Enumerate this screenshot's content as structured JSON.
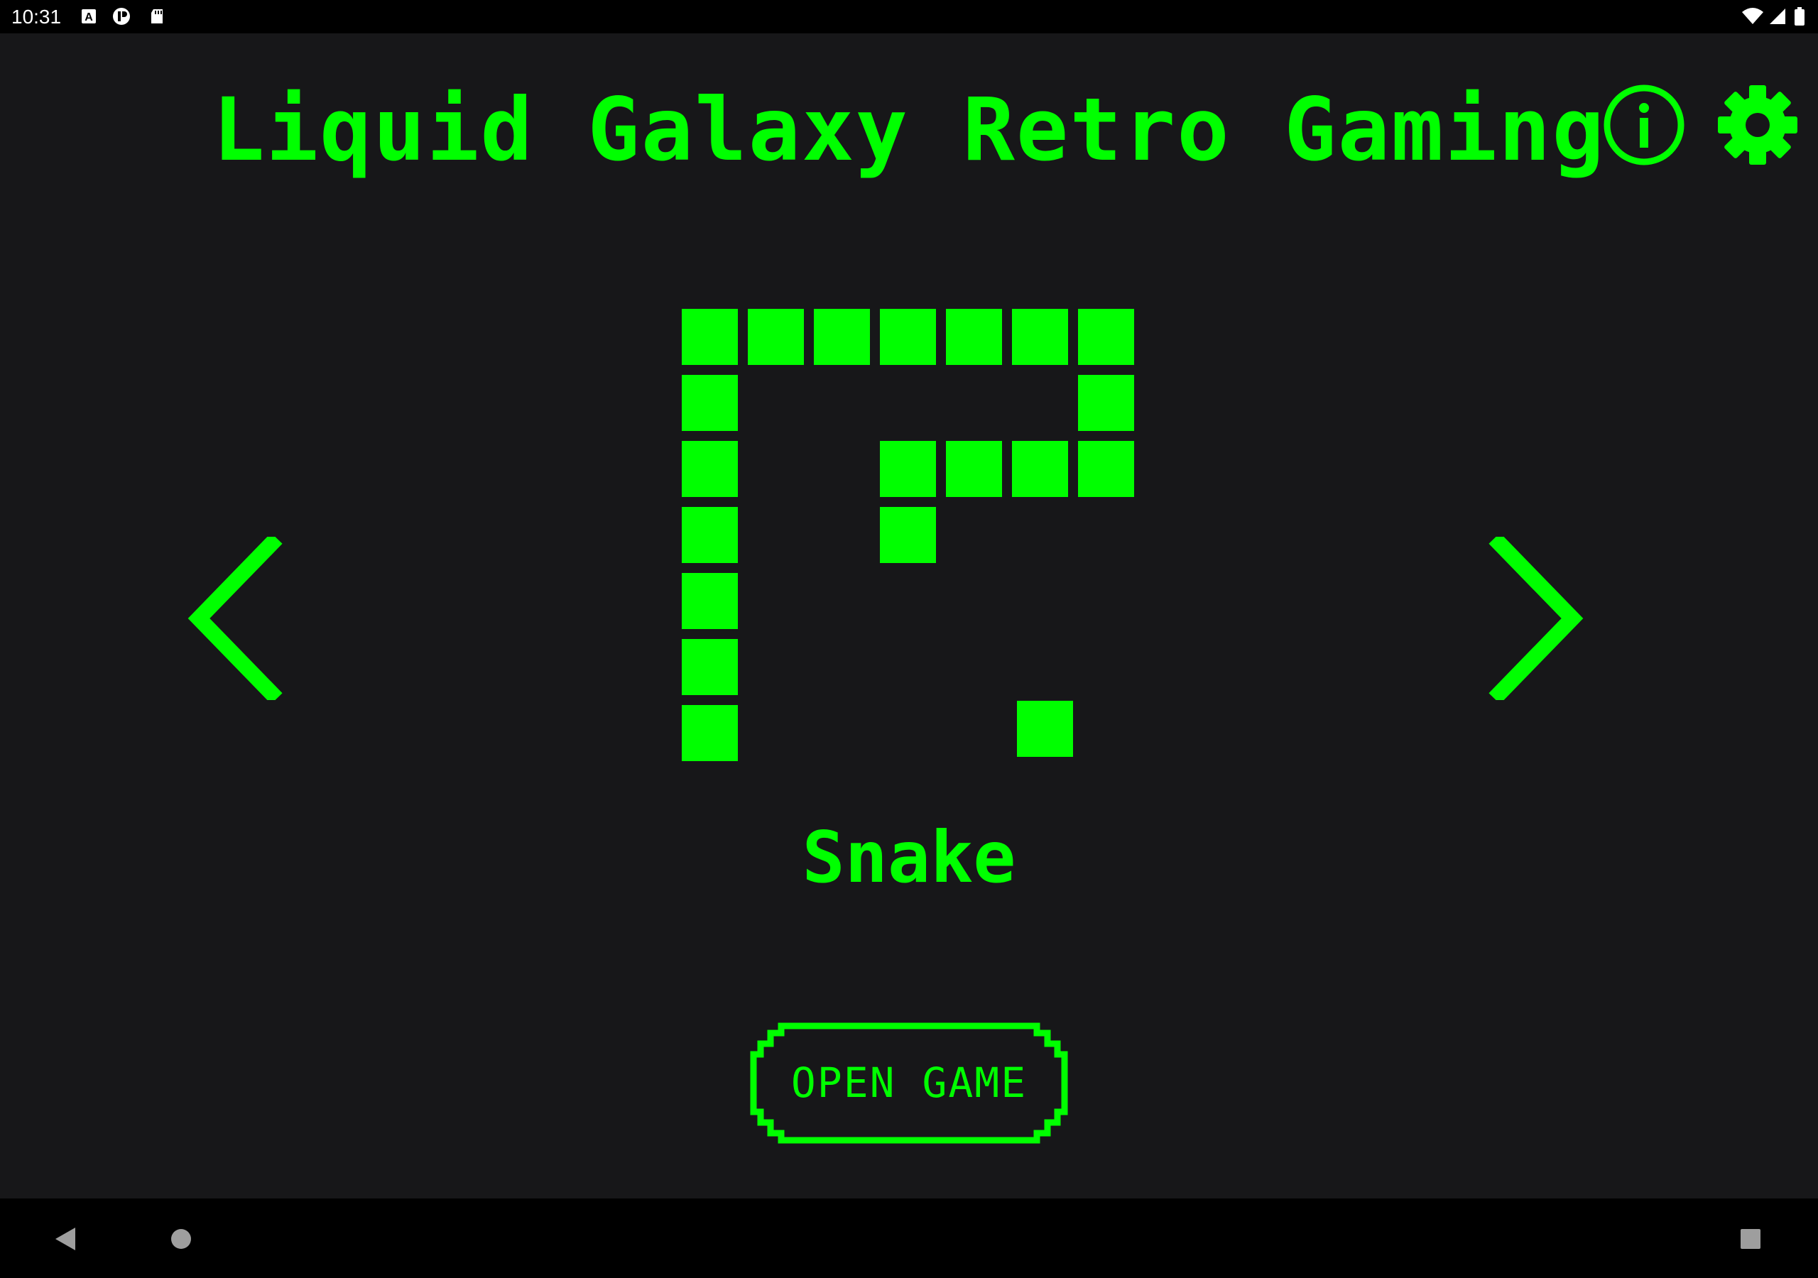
{
  "status_bar": {
    "time": "10:31",
    "left_icons": [
      "keyboard-a-icon",
      "shield-app-icon",
      "sd-card-icon"
    ],
    "right_icons": [
      "wifi-icon",
      "cell-signal-icon",
      "battery-icon"
    ]
  },
  "header": {
    "title": "Liquid Galaxy Retro Gaming",
    "info_icon": "info-circle-icon",
    "settings_icon": "gear-icon"
  },
  "carousel": {
    "prev_icon": "chevron-left-icon",
    "next_icon": "chevron-right-icon",
    "current_game": {
      "name": "Snake",
      "thumbnail_icon": "snake-game-icon"
    }
  },
  "actions": {
    "open_game_label": "OPEN GAME"
  },
  "nav_bar": {
    "back_icon": "back-triangle-icon",
    "home_icon": "home-circle-icon",
    "recents_icon": "recents-square-icon"
  },
  "colors": {
    "accent": "#00ff00",
    "background": "#171719",
    "system_bars": "#000000"
  }
}
